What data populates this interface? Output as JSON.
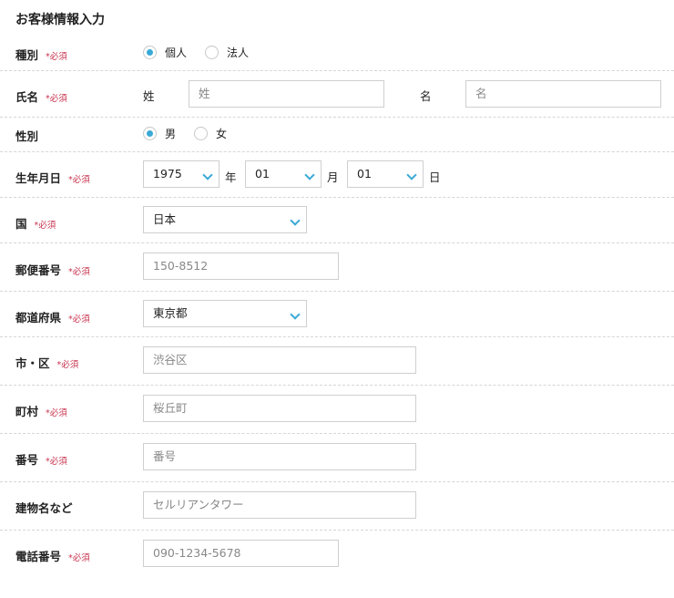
{
  "page_title": "お客様情報入力",
  "required_mark": "*必須",
  "colors": {
    "accent": "#3aa9d6",
    "required": "#c8344f"
  },
  "fields": {
    "type": {
      "label": "種別",
      "options": [
        "個人",
        "法人"
      ],
      "selected": "個人"
    },
    "name": {
      "label": "氏名",
      "last_label": "姓",
      "last_placeholder": "姓",
      "first_label": "名",
      "first_placeholder": "名"
    },
    "gender": {
      "label": "性別",
      "options": [
        "男",
        "女"
      ],
      "selected": "男"
    },
    "birthdate": {
      "label": "生年月日",
      "year": "1975",
      "year_unit": "年",
      "month": "01",
      "month_unit": "月",
      "day": "01",
      "day_unit": "日"
    },
    "country": {
      "label": "国",
      "value": "日本"
    },
    "postal": {
      "label": "郵便番号",
      "placeholder": "150-8512"
    },
    "prefecture": {
      "label": "都道府県",
      "value": "東京都"
    },
    "city": {
      "label": "市・区",
      "placeholder": "渋谷区"
    },
    "town": {
      "label": "町村",
      "placeholder": "桜丘町"
    },
    "number": {
      "label": "番号",
      "placeholder": "番号"
    },
    "building": {
      "label": "建物名など",
      "placeholder": "セルリアンタワー"
    },
    "phone": {
      "label": "電話番号",
      "placeholder": "090-1234-5678"
    }
  }
}
